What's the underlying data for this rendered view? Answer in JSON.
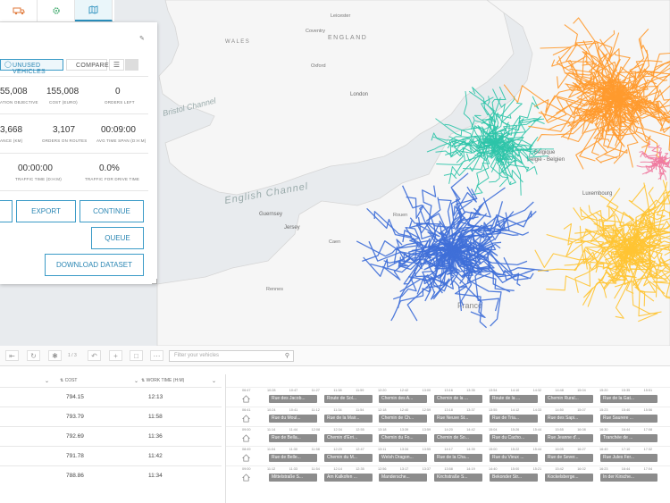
{
  "tabs": [
    {
      "name": "vehicles-tab",
      "icon": "truck-icon"
    },
    {
      "name": "settings-tab",
      "icon": "gear-icon"
    },
    {
      "name": "map-tab",
      "icon": "map-icon"
    }
  ],
  "map": {
    "labels": {
      "wales": "WALES",
      "england": "ENGLAND",
      "bristol": "Bristol Channel",
      "english_channel": "English Channel",
      "guernsey": "Guernsey",
      "jersey": "Jersey",
      "france": "France",
      "belgique": "Belgique",
      "belgie": "België - Belgien",
      "luxembourg": "Luxembourg",
      "leicester": "Leicester",
      "coventry": "Coventry",
      "oxford": "Oxford",
      "london": "London",
      "dundee": "Dundee",
      "caen": "Caen",
      "rouen": "Rouen",
      "rennes": "Rennes"
    },
    "colors": {
      "teal": "#2ec4a8",
      "blue": "#3f6fd8",
      "orange": "#ff9a2e",
      "yellow": "#ffc433",
      "pink": "#f07aa0",
      "water": "#e9ecef",
      "land": "#f7f7f7"
    }
  },
  "panel": {
    "pills": {
      "unused": "UNUSED VEHICLES",
      "compare": "COMPARE"
    },
    "stats": [
      {
        "value": "55,008",
        "label": "ATION OBJECTIVE"
      },
      {
        "value": "155,008",
        "label": "COST (EURO)"
      },
      {
        "value": "0",
        "label": "ORDERS LEFT"
      },
      {
        "value": "3,668",
        "label": "ANCE (KM)"
      },
      {
        "value": "3,107",
        "label": "ORDERS ON ROUTES"
      },
      {
        "value": "00:09:00",
        "label": "AVG TIME SPAN (D:H:M)"
      },
      {
        "value": "00:00:00",
        "label": "TRAFFIC TIME (D:H:M)"
      },
      {
        "value": "0.0%",
        "label": "TRAFFIC FOR DRIVE TIME"
      }
    ],
    "buttons": {
      "export": "EXPORT",
      "continue": "CONTINUE",
      "queue": "QUEUE",
      "download": "DOWNLOAD DATASET"
    }
  },
  "toolbar": {
    "range": "1 / 3",
    "filter_placeholder": "Filter your vehicles"
  },
  "columns": {
    "cost": "COST",
    "work_time": "WORK TIME (H:M)"
  },
  "rows": [
    {
      "cost": "794.15",
      "work_time": "12:13",
      "start": "06:47",
      "ticks": [
        "10:28",
        "10:47",
        "11:27",
        "11:38",
        "11:59",
        "12:20",
        "12:42",
        "13:00",
        "13:16",
        "13:35",
        "13:54",
        "14:10",
        "14:32",
        "14:48",
        "15:04",
        "15:20",
        "15:35",
        "15:51"
      ],
      "stops": [
        "Rue des Jacob...",
        "Route de Sol...",
        "Chemin des A...",
        "Chemin de la ...",
        "Route de la ...",
        "Chemin Rural...",
        "Rue de la Gat..."
      ]
    },
    {
      "cost": "793.79",
      "work_time": "11:58",
      "start": "06:41",
      "ticks": [
        "10:24",
        "10:41",
        "11:12",
        "11:34",
        "11:54",
        "12:18",
        "12:40",
        "12:59",
        "13:18",
        "13:37",
        "13:55",
        "14:12",
        "14:33",
        "14:50",
        "15:07",
        "15:23",
        "15:40",
        "15:56"
      ],
      "stops": [
        "Rue du Moul...",
        "Rue de la Mair...",
        "Chemin de Ch...",
        "Rue Neuve St...",
        "Rue de Tria...",
        "Rue des Sapi...",
        "Rue Saurere ..."
      ]
    },
    {
      "cost": "792.69",
      "work_time": "11:36",
      "start": "09:00",
      "ticks": [
        "11:14",
        "11:44",
        "12:08",
        "12:34",
        "12:55",
        "13:18",
        "13:39",
        "13:59",
        "14:20",
        "14:42",
        "15:04",
        "15:26",
        "15:44",
        "15:55",
        "16:08",
        "16:30",
        "16:44",
        "17:08"
      ],
      "stops": [
        "Rue de Bella...",
        "Chemin d'Erri...",
        "Chemin du Fo...",
        "Chemin de So...",
        "Rue du Cacho...",
        "Rue Jeanne d'...",
        "Tranchée de ..."
      ]
    },
    {
      "cost": "791.78",
      "work_time": "11:42",
      "start": "08:49",
      "ticks": [
        "11:04",
        "11:30",
        "11:58",
        "12:20",
        "12:47",
        "13:11",
        "13:34",
        "13:55",
        "14:17",
        "14:39",
        "15:00",
        "15:22",
        "15:44",
        "16:05",
        "16:27",
        "16:49",
        "17:10",
        "17:32"
      ],
      "stops": [
        "Rue de Belle...",
        "Chemin du M...",
        "Welsh Dragon...",
        "Rue de la Cha...",
        "Rue du Vieux ...",
        "Rue de Sever...",
        "Rue Jules Fer..."
      ]
    },
    {
      "cost": "788.86",
      "work_time": "11:34",
      "start": "09:00",
      "ticks": [
        "11:12",
        "11:33",
        "11:54",
        "12:14",
        "12:35",
        "12:56",
        "13:17",
        "13:37",
        "13:58",
        "14:19",
        "14:40",
        "15:00",
        "15:21",
        "15:42",
        "16:02",
        "16:23",
        "16:44",
        "17:04"
      ],
      "stops": [
        "Mittelstraße S...",
        "Am Kalkofen ...",
        "Mandersche...",
        "Kirchstraße S...",
        "Bekonder Str...",
        "Kockelsberge...",
        "In der Kirsche..."
      ]
    }
  ]
}
